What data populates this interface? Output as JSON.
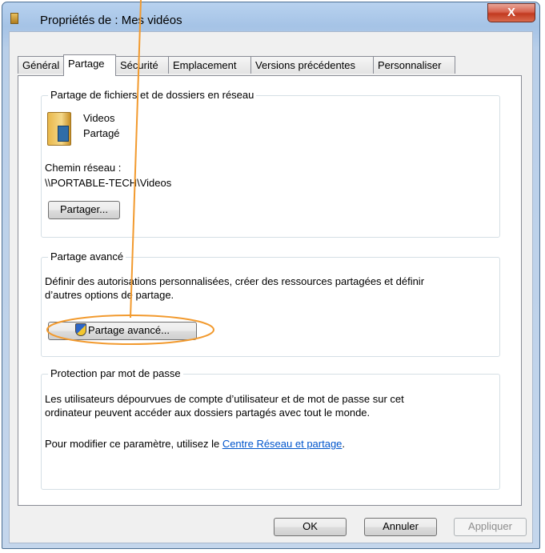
{
  "window": {
    "title": "Propriétés de : Mes vidéos",
    "close_label": "X"
  },
  "tabs": [
    {
      "label": "Général",
      "active": false
    },
    {
      "label": "Partage",
      "active": true
    },
    {
      "label": "Sécurité",
      "active": false
    },
    {
      "label": "Emplacement",
      "active": false
    },
    {
      "label": "Versions précédentes",
      "active": false
    },
    {
      "label": "Personnaliser",
      "active": false
    }
  ],
  "network_share": {
    "group_title": "Partage de fichiers et de dossiers en réseau",
    "folder_name": "Videos",
    "folder_status": "Partagé",
    "path_label": "Chemin réseau :",
    "path_value": "\\\\PORTABLE-TECH\\Videos",
    "share_button": "Partager..."
  },
  "advanced_share": {
    "group_title": "Partage avancé",
    "description_line1": "Définir des autorisations personnalisées, créer des ressources partagées et définir",
    "description_line2": "d’autres options de partage.",
    "button": "Partage avancé..."
  },
  "password_protection": {
    "group_title": "Protection par mot de passe",
    "line1": "Les utilisateurs dépourvues de compte d’utilisateur et de mot de passe sur cet",
    "line2": "ordinateur peuvent accéder aux dossiers partagés avec tout le monde.",
    "modify_prefix": "Pour modifier ce paramètre, utilisez le ",
    "link": "Centre Réseau et partage",
    "modify_suffix": "."
  },
  "footer": {
    "ok": "OK",
    "cancel": "Annuler",
    "apply": "Appliquer"
  },
  "colors": {
    "annotation": "#f29a2e",
    "link": "#0055cc"
  }
}
